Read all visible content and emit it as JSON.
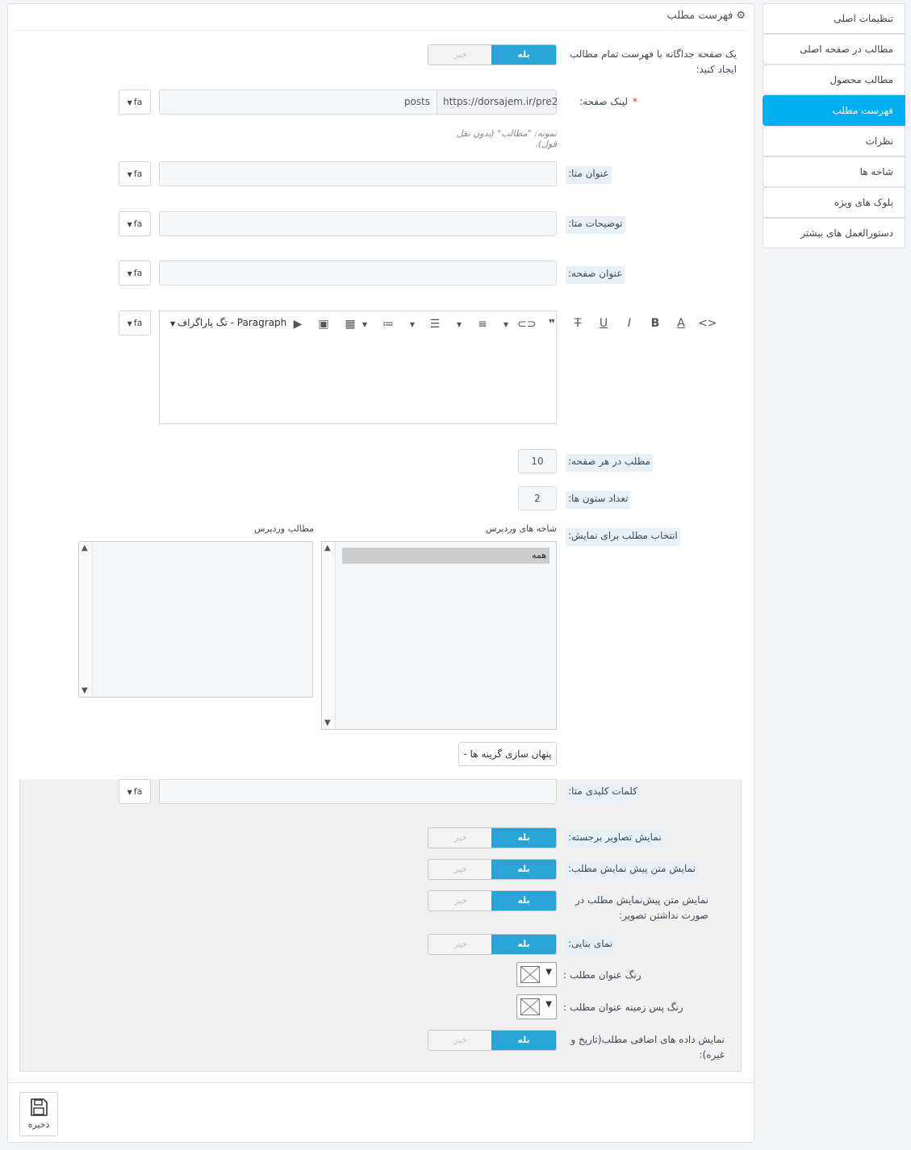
{
  "tabs": [
    {
      "label": "تنظیمات اصلی",
      "active": false
    },
    {
      "label": "مطالب در صفحه اصلی",
      "active": false
    },
    {
      "label": "مطالب محصول",
      "active": false
    },
    {
      "label": "فهرست مطلب",
      "active": true
    },
    {
      "label": "نظرات",
      "active": false
    },
    {
      "label": "شاخه ها",
      "active": false
    },
    {
      "label": "بلوک های ویژه",
      "active": false
    },
    {
      "label": "دستورالعمل های بیشتر",
      "active": false
    }
  ],
  "panel": {
    "title": "فهرست مطلب",
    "title_icon": "gears-icon"
  },
  "switch_labels": {
    "yes": "بله",
    "no": "خیر"
  },
  "lang": "fa",
  "fields": {
    "separate_page": "یک صفحه جداگانه با فهرست تمام مطالب ایجاد کنید:",
    "page_link": "لینک صفحه:",
    "page_link_required": "*",
    "url_prefix": "https://dorsajem.ir/pre2",
    "url_value": "posts",
    "example_hint": "نمونه: \"مطالب\" (بدون نقل قول).",
    "meta_title": "عنوان متا:",
    "meta_description": "توضیحات متا:",
    "page_title": "عنوان صفحه:",
    "posts_per_page": "مطلب در هر صفحه:",
    "posts_per_page_value": "10",
    "columns": "تعداد ستون ها:",
    "columns_value": "2",
    "select_posts": "انتخاب مطلب برای نمایش:",
    "wp_categories": "شاخه های وردپرس",
    "wp_categories_option": "همه",
    "wp_posts": "مطالب وردپرس",
    "hide_options": "پنهان سازی گزینه ها -",
    "meta_keywords": "کلمات کلیدی متا:",
    "show_featured": "نمایش تصاویر برجسته:",
    "show_excerpt": "نمایش متن پیش نمایش مطلب:",
    "show_excerpt_noimg": "نمایش متن پیش‌نمایش مطلب در صورت نداشتن تصویر:",
    "masonry": "نمای بنایی:",
    "title_color": "رنگ عنوان مطلب :",
    "title_bg_color": "رنگ پس زمینه عنوان مطلب :",
    "show_meta": "نمایش داده های اضافی مطلب(تاریخ و غیره):"
  },
  "editor": {
    "paragraph": "تگ پاراگراف - Paragraph"
  },
  "save": {
    "label": "ذخیره"
  },
  "colors": {
    "accent": "#00aff0",
    "switch_on": "#2aa3d6"
  }
}
